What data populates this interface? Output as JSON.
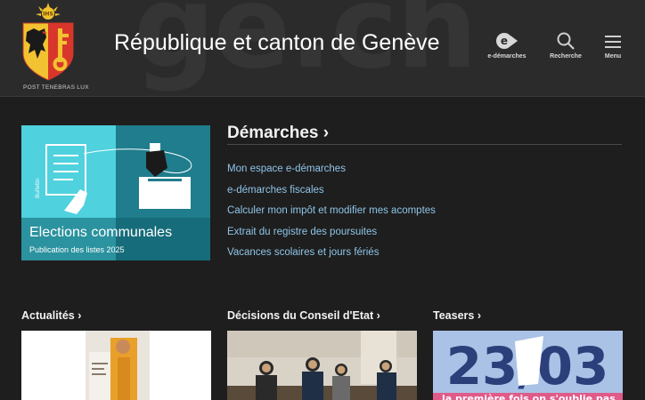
{
  "header": {
    "watermark": "ge.ch",
    "motto": "POST TENEBRAS LUX",
    "title": "République et canton de Genève",
    "buttons": [
      {
        "label": "e-démarches",
        "icon": "e-demarches-icon"
      },
      {
        "label": "Recherche",
        "icon": "search-icon"
      },
      {
        "label": "Menu",
        "icon": "hamburger-menu-icon"
      }
    ]
  },
  "feature": {
    "side_label": "Bulletin",
    "title": "Elections communales",
    "subtitle": "Publication des listes 2025"
  },
  "demarches": {
    "title": "Démarches",
    "links": [
      "Mon espace e-démarches",
      "e-démarches fiscales",
      "Calculer mon impôt et modifier mes acomptes",
      "Extrait du registre des poursuites",
      "Vacances scolaires et jours fériés"
    ]
  },
  "sections": [
    {
      "title": "Actualités"
    },
    {
      "title": "Décisions du Conseil d'Etat"
    },
    {
      "title": "Teasers"
    }
  ],
  "teaser": {
    "big_text": "23/03",
    "caption": "la première fois on s'oublie pas"
  },
  "chevron": "›",
  "colors": {
    "header_bg": "#2b2b2b",
    "page_bg": "#1e1e1e",
    "link": "#8ec5e8",
    "feature_cyan": "#4fd1de",
    "feature_teal": "#1f7d8d"
  }
}
